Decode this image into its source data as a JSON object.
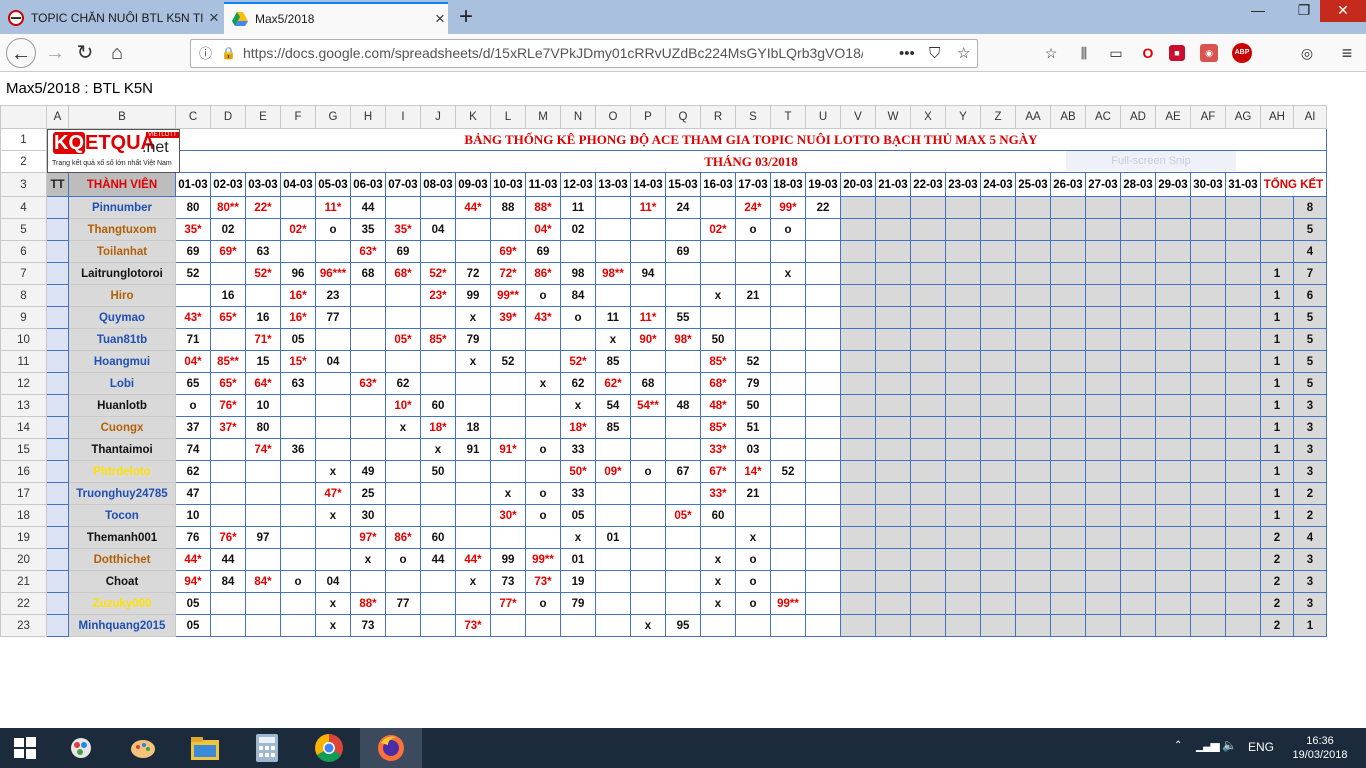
{
  "browser": {
    "tabs": [
      {
        "label": "TOPIC CHĂN NUÔI BTL K5N TI",
        "active": false
      },
      {
        "label": "Max5/2018",
        "active": true
      }
    ],
    "new_tab": "+",
    "window": {
      "minimize": "—",
      "restore": "❐",
      "close": "✕"
    },
    "url": "https://docs.google.com/spreadsheets/d/15xRLe7VPkJDmy01cRRvUZdBc224MsGYIbLQrb3gVO18/ht",
    "url_more": "•••",
    "nav": {
      "back": "←",
      "forward": "→",
      "reload": "↻",
      "home": "⌂"
    },
    "menu": "≡"
  },
  "doc_title": "Max5/2018 : BTL K5N",
  "sheet": {
    "columns": [
      "",
      "A",
      "B",
      "C",
      "D",
      "E",
      "F",
      "G",
      "H",
      "I",
      "J",
      "K",
      "L",
      "M",
      "N",
      "O",
      "P",
      "Q",
      "R",
      "S",
      "T",
      "U",
      "V",
      "W",
      "X",
      "Y",
      "Z",
      "AA",
      "AB",
      "AC",
      "AD",
      "AE",
      "AF",
      "AG",
      "AH",
      "AI"
    ],
    "title": "BẢNG THỐNG KÊ PHONG ĐỘ ACE THAM GIA TOPIC NUÔI LOTTO BẠCH THỦ MAX 5 NGÀY",
    "subtitle": "THÁNG 03/2018",
    "header_tt": "TT",
    "header_member": "THÀNH VIÊN",
    "header_total": "TỔNG KẾT",
    "dates": [
      "01-03",
      "02-03",
      "03-03",
      "04-03",
      "05-03",
      "06-03",
      "07-03",
      "08-03",
      "09-03",
      "10-03",
      "11-03",
      "12-03",
      "13-03",
      "14-03",
      "15-03",
      "16-03",
      "17-03",
      "18-03",
      "19-03",
      "20-03",
      "21-03",
      "22-03",
      "23-03",
      "24-03",
      "25-03",
      "26-03",
      "27-03",
      "28-03",
      "29-03",
      "30-03",
      "31-03"
    ],
    "logo": {
      "brand_k": "KQ",
      "brand_rest": "ETQUA",
      "net": ".net",
      "badge": "VIETLOTT",
      "tagline": "Trang kết quả xổ số lớn nhất Việt Nam"
    },
    "members": [
      {
        "row": "4",
        "name": "Pinnumber",
        "color": "blue",
        "cells": [
          "80",
          "80**",
          "22*",
          "",
          "11*",
          "44",
          "",
          "",
          "44*",
          "88",
          "88*",
          "11",
          "",
          "11*",
          "24",
          "",
          "24*",
          "99*",
          "22"
        ],
        "ah": "",
        "ai": "8"
      },
      {
        "row": "5",
        "name": "Thangtuxom",
        "color": "brown",
        "cells": [
          "35*",
          "02",
          "",
          "02*",
          "o",
          "35",
          "35*",
          "04",
          "",
          "",
          "04*",
          "02",
          "",
          "",
          "",
          "02*",
          "o",
          "o"
        ],
        "ah": "",
        "ai": "5"
      },
      {
        "row": "6",
        "name": "Toilanhat",
        "color": "brown",
        "cells": [
          "69",
          "69*",
          "63",
          "",
          "",
          "63*",
          "69",
          "",
          "",
          "69*",
          "69",
          "",
          "",
          "",
          "69"
        ],
        "ah": "",
        "ai": "4"
      },
      {
        "row": "7",
        "name": "Laitrunglotoroi",
        "color": "black",
        "cells": [
          "52",
          "",
          "52*",
          "96",
          "96***",
          "68",
          "68*",
          "52*",
          "72",
          "72*",
          "86*",
          "98",
          "98**",
          "94",
          "",
          "",
          "",
          "x"
        ],
        "ah": "1",
        "ai": "7"
      },
      {
        "row": "8",
        "name": "Hiro",
        "color": "brown",
        "cells": [
          "",
          "16",
          "",
          "16*",
          "23",
          "",
          "",
          "23*",
          "99",
          "99**",
          "o",
          "84",
          "",
          "",
          "",
          "x",
          "21"
        ],
        "ah": "1",
        "ai": "6"
      },
      {
        "row": "9",
        "name": "Quymao",
        "color": "blue",
        "cells": [
          "43*",
          "65*",
          "16",
          "16*",
          "77",
          "",
          "",
          "",
          "x",
          "39*",
          "43*",
          "o",
          "11",
          "11*",
          "55"
        ],
        "ah": "1",
        "ai": "5"
      },
      {
        "row": "10",
        "name": "Tuan81tb",
        "color": "blue",
        "cells": [
          "71",
          "",
          "71*",
          "05",
          "",
          "",
          "05*",
          "85*",
          "79",
          "",
          "",
          "",
          "x",
          "90*",
          "98*",
          "50"
        ],
        "ah": "1",
        "ai": "5"
      },
      {
        "row": "11",
        "name": "Hoangmui",
        "color": "blue",
        "cells": [
          "04*",
          "85**",
          "15",
          "15*",
          "04",
          "",
          "",
          "",
          "x",
          "52",
          "",
          "52*",
          "85",
          "",
          "",
          "85*",
          "52"
        ],
        "ah": "1",
        "ai": "5"
      },
      {
        "row": "12",
        "name": "Lobi",
        "color": "blue",
        "cells": [
          "65",
          "65*",
          "64*",
          "63",
          "",
          "63*",
          "62",
          "",
          "",
          "",
          "x",
          "62",
          "62*",
          "68",
          "",
          "68*",
          "79"
        ],
        "ah": "1",
        "ai": "5"
      },
      {
        "row": "13",
        "name": "Huanlotb",
        "color": "black",
        "cells": [
          "o",
          "76*",
          "10",
          "",
          "",
          "",
          "10*",
          "60",
          "",
          "",
          "",
          "x",
          "54",
          "54**",
          "48",
          "48*",
          "50"
        ],
        "ah": "1",
        "ai": "3"
      },
      {
        "row": "14",
        "name": "Cuongx",
        "color": "brown",
        "cells": [
          "37",
          "37*",
          "80",
          "",
          "",
          "",
          "x",
          "18*",
          "18",
          "",
          "",
          "18*",
          "85",
          "",
          "",
          "85*",
          "51"
        ],
        "ah": "1",
        "ai": "3"
      },
      {
        "row": "15",
        "name": "Thantaimoi",
        "color": "black",
        "cells": [
          "74",
          "",
          "74*",
          "36",
          "",
          "",
          "",
          "x",
          "91",
          "91*",
          "o",
          "33",
          "",
          "",
          "",
          "33*",
          "03"
        ],
        "ah": "1",
        "ai": "3"
      },
      {
        "row": "16",
        "name": "Phtrdeloto",
        "color": "yellow",
        "cells": [
          "62",
          "",
          "",
          "",
          "x",
          "49",
          "",
          "50",
          "",
          "",
          "",
          "50*",
          "09*",
          "o",
          "67",
          "67*",
          "14*",
          "52"
        ],
        "ah": "1",
        "ai": "3"
      },
      {
        "row": "17",
        "name": "Truonghuy24785",
        "color": "blue",
        "cells": [
          "47",
          "",
          "",
          "",
          "47*",
          "25",
          "",
          "",
          "",
          "x",
          "o",
          "33",
          "",
          "",
          "",
          "33*",
          "21"
        ],
        "ah": "1",
        "ai": "2"
      },
      {
        "row": "18",
        "name": "Tocon",
        "color": "blue",
        "cells": [
          "10",
          "",
          "",
          "",
          "x",
          "30",
          "",
          "",
          "",
          "30*",
          "o",
          "05",
          "",
          "",
          "05*",
          "60"
        ],
        "ah": "1",
        "ai": "2"
      },
      {
        "row": "19",
        "name": "Themanh001",
        "color": "black",
        "cells": [
          "76",
          "76*",
          "97",
          "",
          "",
          "97*",
          "86*",
          "60",
          "",
          "",
          "",
          "x",
          "01",
          "",
          "",
          "",
          "x"
        ],
        "ah": "2",
        "ai": "4"
      },
      {
        "row": "20",
        "name": "Dotthichet",
        "color": "brown",
        "cells": [
          "44*",
          "44",
          "",
          "",
          "",
          "x",
          "o",
          "44",
          "44*",
          "99",
          "99**",
          "01",
          "",
          "",
          "",
          "x",
          "o"
        ],
        "ah": "2",
        "ai": "3"
      },
      {
        "row": "21",
        "name": "Choat",
        "color": "black",
        "cells": [
          "94*",
          "84",
          "84*",
          "o",
          "04",
          "",
          "",
          "",
          "x",
          "73",
          "73*",
          "19",
          "",
          "",
          "",
          "x",
          "o"
        ],
        "ah": "2",
        "ai": "3"
      },
      {
        "row": "22",
        "name": "Zuzuky000",
        "color": "yellow",
        "cells": [
          "05",
          "",
          "",
          "",
          "x",
          "88*",
          "77",
          "",
          "",
          "77*",
          "o",
          "79",
          "",
          "",
          "",
          "x",
          "o",
          "99**"
        ],
        "ah": "2",
        "ai": "3"
      },
      {
        "row": "23",
        "name": "Minhquang2015",
        "color": "blue",
        "cells": [
          "05",
          "",
          "",
          "",
          "x",
          "73",
          "",
          "",
          "73*",
          "",
          "",
          "",
          "",
          "x",
          "95"
        ],
        "ah": "2",
        "ai": "1"
      }
    ]
  },
  "overlay": {
    "snip": "Full-screen Snip"
  },
  "taskbar": {
    "apps": [
      "windows-start",
      "paint",
      "paint-3d",
      "file-explorer",
      "calculator",
      "chrome",
      "firefox"
    ],
    "lang": "ENG",
    "time": "16:36",
    "date": "19/03/2018"
  },
  "colors": {
    "accent": "#e00000",
    "blue_name": "#1f4fb4",
    "brown_name": "#b45f06",
    "yellow_name": "#ffe100",
    "table_border": "#4472c4",
    "taskbar": "#1c2b3c"
  }
}
